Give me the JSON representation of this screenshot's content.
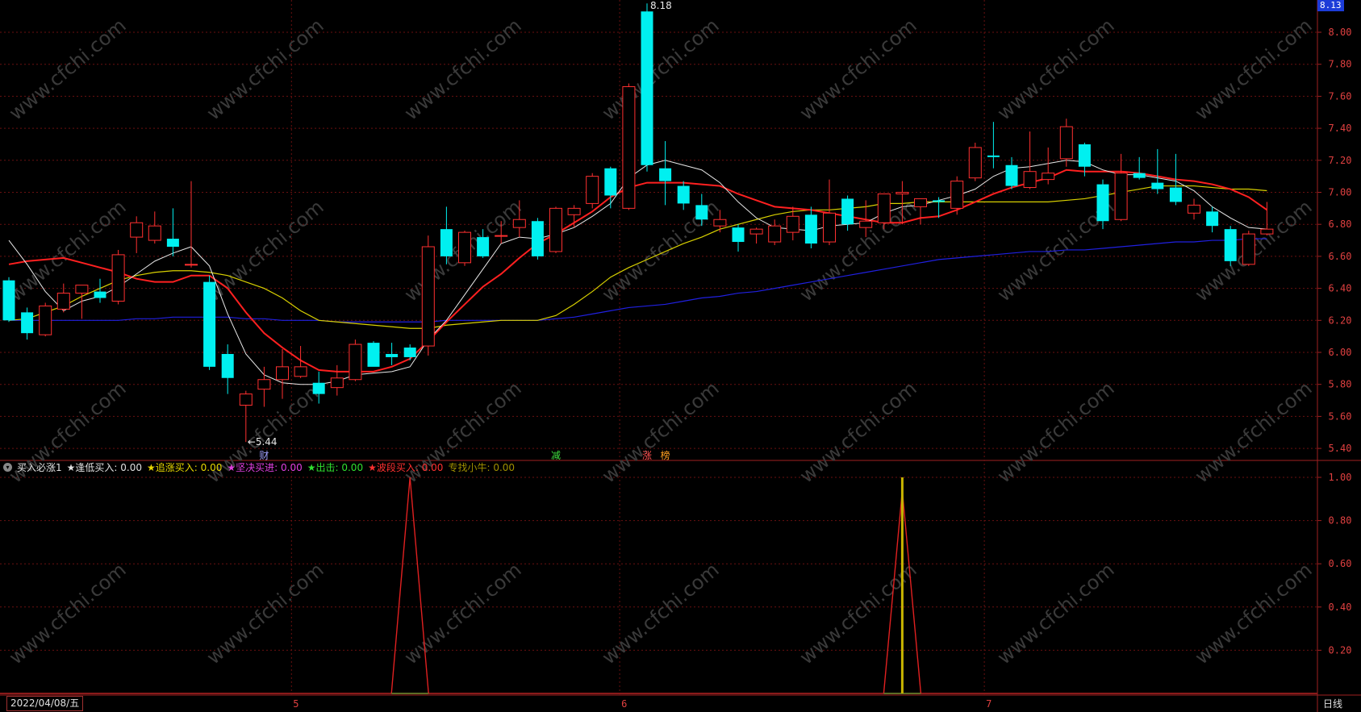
{
  "chart_data": {
    "type": "candlestick",
    "main_axis": {
      "ticks": [
        "8.00",
        "7.80",
        "7.60",
        "7.40",
        "7.20",
        "7.00",
        "6.80",
        "6.60",
        "6.40",
        "6.20",
        "6.00",
        "5.80",
        "5.60",
        "5.40"
      ]
    },
    "sub_axis": {
      "ticks": [
        "1.00",
        "0.80",
        "0.60",
        "0.40",
        "0.20"
      ]
    },
    "x_labels": [
      "5",
      "6",
      "7"
    ],
    "candles": [
      {
        "o": 6.45,
        "h": 6.47,
        "l": 6.19,
        "c": 6.2
      },
      {
        "o": 6.25,
        "h": 6.28,
        "l": 6.08,
        "c": 6.12
      },
      {
        "o": 6.11,
        "h": 6.31,
        "l": 6.1,
        "c": 6.29
      },
      {
        "o": 6.27,
        "h": 6.43,
        "l": 6.25,
        "c": 6.37
      },
      {
        "o": 6.37,
        "h": 6.41,
        "l": 6.21,
        "c": 6.42
      },
      {
        "o": 6.38,
        "h": 6.46,
        "l": 6.31,
        "c": 6.34
      },
      {
        "o": 6.32,
        "h": 6.64,
        "l": 6.3,
        "c": 6.61
      },
      {
        "o": 6.72,
        "h": 6.85,
        "l": 6.62,
        "c": 6.81
      },
      {
        "o": 6.7,
        "h": 6.88,
        "l": 6.68,
        "c": 6.79
      },
      {
        "o": 6.71,
        "h": 6.9,
        "l": 6.6,
        "c": 6.66
      },
      {
        "o": 6.55,
        "h": 7.07,
        "l": 6.53,
        "c": 6.55
      },
      {
        "o": 6.44,
        "h": 6.48,
        "l": 5.89,
        "c": 5.91
      },
      {
        "o": 5.99,
        "h": 6.05,
        "l": 5.74,
        "c": 5.84
      },
      {
        "o": 5.67,
        "h": 5.76,
        "l": 5.44,
        "c": 5.74
      },
      {
        "o": 5.77,
        "h": 5.91,
        "l": 5.66,
        "c": 5.83
      },
      {
        "o": 5.83,
        "h": 6.02,
        "l": 5.71,
        "c": 5.91
      },
      {
        "o": 5.85,
        "h": 6.04,
        "l": 5.84,
        "c": 5.91
      },
      {
        "o": 5.81,
        "h": 5.88,
        "l": 5.68,
        "c": 5.74
      },
      {
        "o": 5.78,
        "h": 5.92,
        "l": 5.73,
        "c": 5.84
      },
      {
        "o": 5.83,
        "h": 6.08,
        "l": 5.82,
        "c": 6.05
      },
      {
        "o": 6.06,
        "h": 6.07,
        "l": 5.92,
        "c": 5.91
      },
      {
        "o": 5.99,
        "h": 6.06,
        "l": 5.92,
        "c": 5.97
      },
      {
        "o": 6.03,
        "h": 6.05,
        "l": 5.95,
        "c": 5.97
      },
      {
        "o": 6.04,
        "h": 6.73,
        "l": 5.98,
        "c": 6.66
      },
      {
        "o": 6.77,
        "h": 6.91,
        "l": 6.55,
        "c": 6.6
      },
      {
        "o": 6.56,
        "h": 6.76,
        "l": 6.54,
        "c": 6.75
      },
      {
        "o": 6.72,
        "h": 6.77,
        "l": 6.59,
        "c": 6.6
      },
      {
        "o": 6.73,
        "h": 6.82,
        "l": 6.68,
        "c": 6.73
      },
      {
        "o": 6.78,
        "h": 6.95,
        "l": 6.72,
        "c": 6.83
      },
      {
        "o": 6.82,
        "h": 6.84,
        "l": 6.58,
        "c": 6.6
      },
      {
        "o": 6.63,
        "h": 6.91,
        "l": 6.62,
        "c": 6.9
      },
      {
        "o": 6.86,
        "h": 6.92,
        "l": 6.78,
        "c": 6.9
      },
      {
        "o": 6.93,
        "h": 7.12,
        "l": 6.9,
        "c": 7.1
      },
      {
        "o": 7.15,
        "h": 7.16,
        "l": 6.9,
        "c": 6.98
      },
      {
        "o": 6.9,
        "h": 7.68,
        "l": 6.89,
        "c": 7.66
      },
      {
        "o": 8.13,
        "h": 8.18,
        "l": 7.13,
        "c": 7.17
      },
      {
        "o": 7.15,
        "h": 7.32,
        "l": 6.92,
        "c": 7.07
      },
      {
        "o": 7.04,
        "h": 7.07,
        "l": 6.89,
        "c": 6.93
      },
      {
        "o": 6.92,
        "h": 6.99,
        "l": 6.79,
        "c": 6.83
      },
      {
        "o": 6.79,
        "h": 6.89,
        "l": 6.75,
        "c": 6.83
      },
      {
        "o": 6.78,
        "h": 6.8,
        "l": 6.63,
        "c": 6.69
      },
      {
        "o": 6.74,
        "h": 6.78,
        "l": 6.68,
        "c": 6.77
      },
      {
        "o": 6.69,
        "h": 6.83,
        "l": 6.67,
        "c": 6.79
      },
      {
        "o": 6.75,
        "h": 6.91,
        "l": 6.7,
        "c": 6.85
      },
      {
        "o": 6.86,
        "h": 6.91,
        "l": 6.65,
        "c": 6.68
      },
      {
        "o": 6.69,
        "h": 7.08,
        "l": 6.67,
        "c": 6.87
      },
      {
        "o": 6.96,
        "h": 6.98,
        "l": 6.76,
        "c": 6.8
      },
      {
        "o": 6.78,
        "h": 6.95,
        "l": 6.72,
        "c": 6.82
      },
      {
        "o": 6.81,
        "h": 6.99,
        "l": 6.77,
        "c": 6.99
      },
      {
        "o": 6.99,
        "h": 7.07,
        "l": 6.8,
        "c": 7.0
      },
      {
        "o": 6.91,
        "h": 6.96,
        "l": 6.8,
        "c": 6.96
      },
      {
        "o": 6.95,
        "h": 6.97,
        "l": 6.84,
        "c": 6.94
      },
      {
        "o": 6.9,
        "h": 7.1,
        "l": 6.86,
        "c": 7.07
      },
      {
        "o": 7.09,
        "h": 7.31,
        "l": 7.07,
        "c": 7.28
      },
      {
        "o": 7.23,
        "h": 7.44,
        "l": 7.15,
        "c": 7.22
      },
      {
        "o": 7.17,
        "h": 7.22,
        "l": 7.02,
        "c": 7.04
      },
      {
        "o": 7.03,
        "h": 7.38,
        "l": 7.02,
        "c": 7.13
      },
      {
        "o": 7.08,
        "h": 7.28,
        "l": 7.05,
        "c": 7.12
      },
      {
        "o": 7.21,
        "h": 7.46,
        "l": 7.16,
        "c": 7.41
      },
      {
        "o": 7.3,
        "h": 7.31,
        "l": 7.1,
        "c": 7.16
      },
      {
        "o": 7.05,
        "h": 7.08,
        "l": 6.77,
        "c": 6.82
      },
      {
        "o": 6.83,
        "h": 7.24,
        "l": 6.82,
        "c": 7.12
      },
      {
        "o": 7.12,
        "h": 7.22,
        "l": 7.08,
        "c": 7.09
      },
      {
        "o": 7.06,
        "h": 7.27,
        "l": 6.99,
        "c": 7.02
      },
      {
        "o": 7.03,
        "h": 7.24,
        "l": 6.92,
        "c": 6.94
      },
      {
        "o": 6.87,
        "h": 6.96,
        "l": 6.83,
        "c": 6.92
      },
      {
        "o": 6.88,
        "h": 6.91,
        "l": 6.75,
        "c": 6.79
      },
      {
        "o": 6.77,
        "h": 6.79,
        "l": 6.54,
        "c": 6.57
      },
      {
        "o": 6.55,
        "h": 6.76,
        "l": 6.54,
        "c": 6.74
      },
      {
        "o": 6.74,
        "h": 6.94,
        "l": 6.73,
        "c": 6.77
      }
    ],
    "ma_white": [
      6.7,
      6.55,
      6.38,
      6.26,
      6.32,
      6.35,
      6.41,
      6.49,
      6.57,
      6.62,
      6.66,
      6.54,
      6.24,
      5.99,
      5.86,
      5.81,
      5.8,
      5.8,
      5.82,
      5.86,
      5.87,
      5.88,
      5.91,
      6.08,
      6.2,
      6.36,
      6.52,
      6.68,
      6.72,
      6.71,
      6.74,
      6.78,
      6.85,
      6.93,
      7.09,
      7.17,
      7.2,
      7.17,
      7.14,
      7.06,
      6.94,
      6.84,
      6.78,
      6.77,
      6.76,
      6.79,
      6.8,
      6.81,
      6.87,
      6.91,
      6.92,
      6.95,
      6.98,
      7.02,
      7.1,
      7.15,
      7.16,
      7.18,
      7.2,
      7.19,
      7.14,
      7.11,
      7.11,
      7.09,
      7.07,
      7.01,
      6.91,
      6.84,
      6.78,
      6.77
    ],
    "ma_red": [
      6.55,
      6.57,
      6.58,
      6.59,
      6.56,
      6.53,
      6.5,
      6.46,
      6.44,
      6.44,
      6.48,
      6.48,
      6.4,
      6.25,
      6.12,
      6.03,
      5.95,
      5.89,
      5.88,
      5.88,
      5.88,
      5.91,
      5.96,
      6.07,
      6.19,
      6.3,
      6.41,
      6.49,
      6.59,
      6.68,
      6.74,
      6.81,
      6.88,
      6.97,
      7.03,
      7.06,
      7.06,
      7.06,
      7.05,
      7.04,
      6.99,
      6.95,
      6.91,
      6.9,
      6.89,
      6.87,
      6.85,
      6.83,
      6.81,
      6.81,
      6.84,
      6.85,
      6.89,
      6.94,
      6.99,
      7.03,
      7.06,
      7.09,
      7.14,
      7.13,
      7.13,
      7.13,
      7.12,
      7.1,
      7.08,
      7.07,
      7.05,
      7.02,
      6.97,
      6.89
    ],
    "ma_yellow": [
      6.2,
      6.21,
      6.25,
      6.29,
      6.35,
      6.4,
      6.45,
      6.48,
      6.5,
      6.51,
      6.51,
      6.5,
      6.48,
      6.44,
      6.4,
      6.34,
      6.26,
      6.2,
      6.19,
      6.18,
      6.17,
      6.16,
      6.15,
      6.15,
      6.17,
      6.18,
      6.19,
      6.2,
      6.2,
      6.2,
      6.23,
      6.3,
      6.38,
      6.47,
      6.53,
      6.58,
      6.63,
      6.68,
      6.72,
      6.77,
      6.8,
      6.83,
      6.86,
      6.88,
      6.89,
      6.89,
      6.9,
      6.91,
      6.93,
      6.93,
      6.94,
      6.94,
      6.94,
      6.94,
      6.94,
      6.94,
      6.94,
      6.94,
      6.95,
      6.96,
      6.98,
      7.0,
      7.02,
      7.04,
      7.04,
      7.04,
      7.03,
      7.02,
      7.02,
      7.01
    ],
    "ma_blue": [
      6.2,
      6.2,
      6.2,
      6.2,
      6.2,
      6.2,
      6.2,
      6.21,
      6.21,
      6.22,
      6.22,
      6.22,
      6.22,
      6.21,
      6.21,
      6.2,
      6.2,
      6.2,
      6.19,
      6.19,
      6.19,
      6.19,
      6.19,
      6.19,
      6.2,
      6.2,
      6.2,
      6.2,
      6.2,
      6.2,
      6.21,
      6.22,
      6.24,
      6.26,
      6.28,
      6.29,
      6.3,
      6.32,
      6.34,
      6.35,
      6.37,
      6.38,
      6.4,
      6.42,
      6.44,
      6.46,
      6.48,
      6.5,
      6.52,
      6.54,
      6.56,
      6.58,
      6.59,
      6.6,
      6.61,
      6.62,
      6.63,
      6.63,
      6.64,
      6.64,
      6.65,
      6.66,
      6.67,
      6.68,
      6.69,
      6.69,
      6.7,
      6.7,
      6.71,
      6.71
    ],
    "signals": [
      {
        "index": 22,
        "value": 1.0,
        "color": "#e02020"
      },
      {
        "index": 49,
        "value": 0.94,
        "color": "#e02020"
      },
      {
        "index": 49,
        "value": 1.0,
        "color": "#c8b400"
      }
    ]
  },
  "annotations": {
    "high_label": "8.18",
    "low_label": "←5.44"
  },
  "markers": [
    {
      "text": "财",
      "color": "#a0a0ff"
    },
    {
      "text": "减",
      "color": "#40e040"
    },
    {
      "text": "涨",
      "color": "#ff5050"
    },
    {
      "text": "榜",
      "color": "#ffa020"
    }
  ],
  "indicator": {
    "name": "买入必涨1",
    "items": [
      {
        "label": "★逢低买入:",
        "value": "0.00",
        "color": "#e0e0e0"
      },
      {
        "label": "★追涨买入:",
        "value": "0.00",
        "color": "#e8d800"
      },
      {
        "label": "★坚决买进:",
        "value": "0.00",
        "color": "#e040e0"
      },
      {
        "label": "★出击:",
        "value": "0.00",
        "color": "#30e030"
      },
      {
        "label": "★波段买入:",
        "value": "0.00",
        "color": "#ff3030"
      },
      {
        "label": "专找小牛:",
        "value": "0.00",
        "color": "#a09000"
      }
    ]
  },
  "price_tag": "8.13",
  "date_label": "2022/04/08/五",
  "period_label": "日线",
  "watermark": "www.cfchi.com",
  "colors": {
    "up": "#ff3030",
    "down": "#00f0f0",
    "grid": "#6a1010",
    "ma_white": "#e8e8e8",
    "ma_red": "#ff2020",
    "ma_yellow": "#d8d000",
    "ma_blue": "#2020e0"
  }
}
